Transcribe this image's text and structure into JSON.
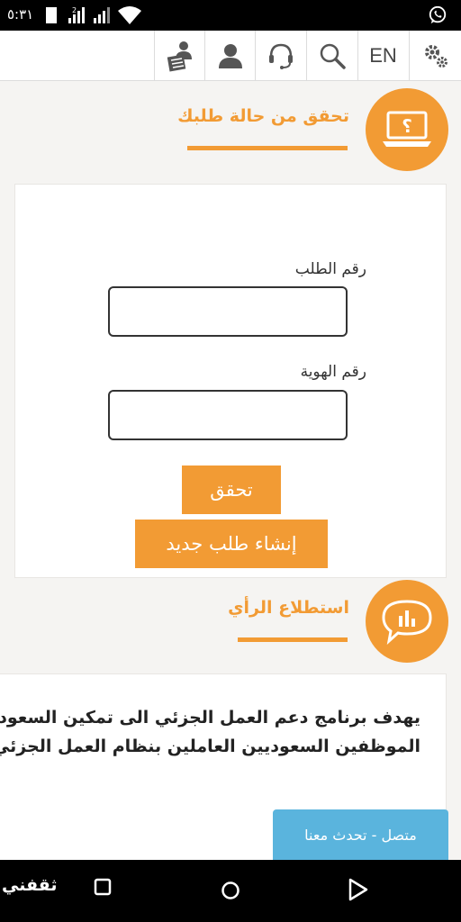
{
  "status_bar": {
    "time": "٥:٣١",
    "icons": [
      "sim-card-icon",
      "signal-icon",
      "wifi-icon",
      "whatsapp-icon"
    ]
  },
  "top_nav": {
    "language_label": "EN",
    "icons": [
      "settings-icon",
      "search-icon",
      "support-headset-icon",
      "user-icon",
      "news-reader-icon"
    ]
  },
  "request_status": {
    "title": "تحقق من حالة طلبك",
    "icon": "laptop-question-icon",
    "form": {
      "request_number_label": "رقم الطلب",
      "request_number_value": "",
      "id_number_label": "رقم الهوية",
      "id_number_value": "",
      "verify_button": "تحقق",
      "new_request_button": "إنشاء طلب جديد"
    }
  },
  "poll": {
    "title": "استطلاع الرأي",
    "icon": "poll-chat-bubble-icon",
    "text_line1": "يهدف برنامج دعم العمل الجزئي الى تمكين السعوديين",
    "text_line2": "الموظفين السعوديين العاملين بنظام العمل الجزئي."
  },
  "chat": {
    "label": "متصل - تحدث معنا"
  },
  "android_nav": {
    "icons": [
      "back-icon",
      "home-icon",
      "recents-icon"
    ]
  },
  "watermark": {
    "text": "ثقفني"
  },
  "colors": {
    "accent": "#f29b34",
    "chat": "#5ab4dd",
    "background": "#f5f4f2"
  }
}
